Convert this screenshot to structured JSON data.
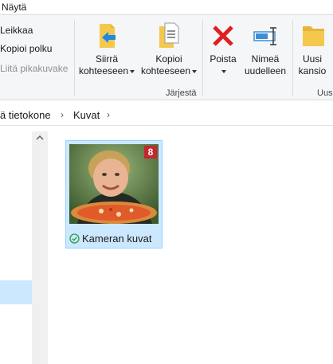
{
  "menu": {
    "tab_view": "Näytä"
  },
  "ribbon": {
    "clipboard": {
      "cut": "Leikkaa",
      "copy_path": "Kopioi polku",
      "paste_shortcut": "Liitä pikakuvake"
    },
    "organize": {
      "move_to_line1": "Siirrä",
      "move_to_line2": "kohteeseen",
      "copy_to_line1": "Kopioi",
      "copy_to_line2": "kohteeseen",
      "delete_line1": "Poista",
      "rename_line1": "Nimeä",
      "rename_line2": "uudelleen",
      "group_label": "Järjestä"
    },
    "new": {
      "new_folder_line1": "Uusi",
      "new_folder_line2": "kansio",
      "group_label": "Uus"
    }
  },
  "address_bar": {
    "crumbs": [
      "ä tietokone",
      "Kuvat"
    ]
  },
  "content": {
    "folder": {
      "name": "Kameran kuvat",
      "count_badge": "8"
    }
  },
  "icons": {
    "move": "move-to-icon",
    "copy": "copy-to-icon",
    "delete": "delete-icon",
    "rename": "rename-icon",
    "new_folder": "new-folder-icon",
    "sync": "sync-status-icon"
  },
  "colors": {
    "badge": "#c4262e",
    "selection": "#cce8ff",
    "delete_red": "#e02020",
    "folder": "#f4c84d",
    "accent_blue": "#1e88e5"
  }
}
